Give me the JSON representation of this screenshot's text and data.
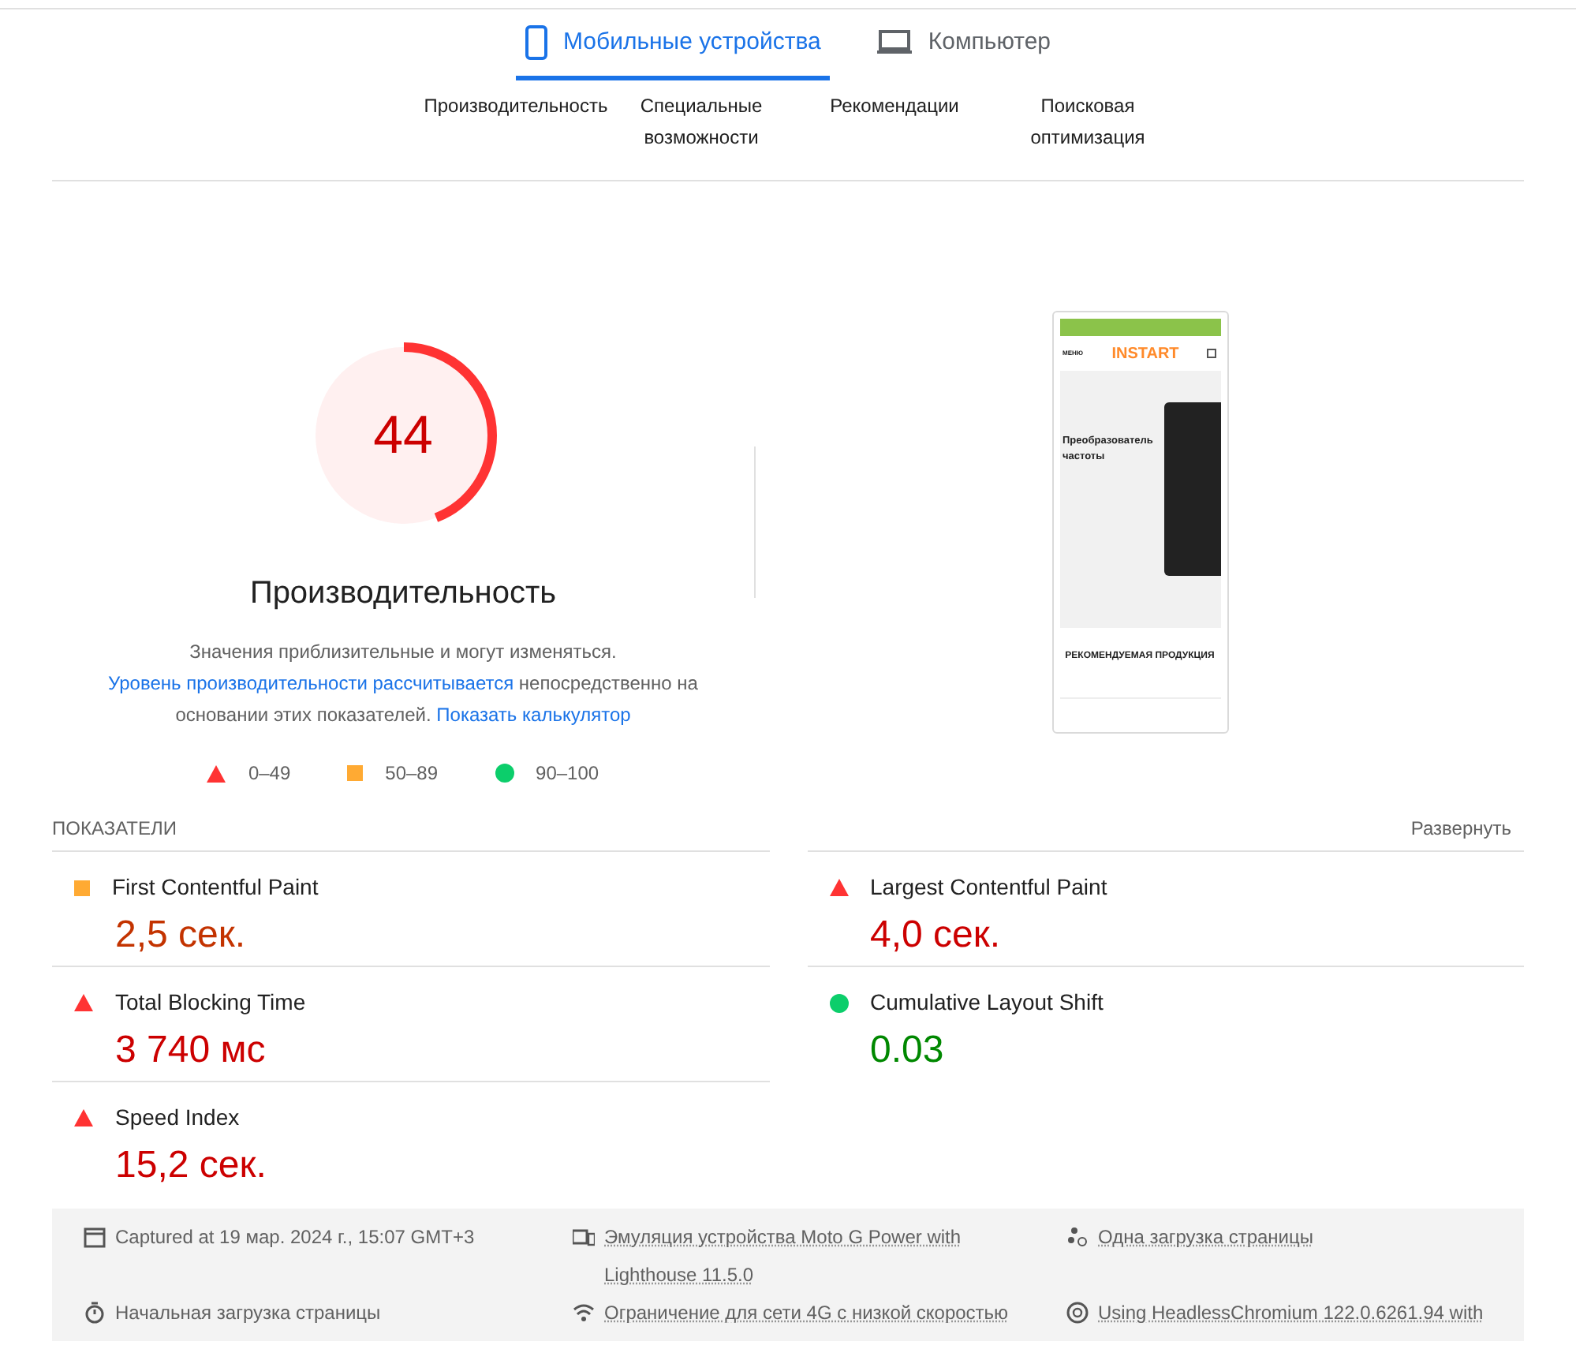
{
  "device_tabs": [
    {
      "label": "Мобильные устройства",
      "kind": "mobile",
      "selected": true
    },
    {
      "label": "Компьютер",
      "kind": "desktop",
      "selected": false
    }
  ],
  "category_tabs": [
    "Производительность",
    "Специальные возможности",
    "Рекомендации",
    "Поисковая оптимизация"
  ],
  "score": {
    "value": "44",
    "level": 0.44,
    "title": "Производительность"
  },
  "description": [
    {
      "kind": "text",
      "text": "Значения приблизительные и могут изменяться."
    },
    {
      "kind": "link",
      "text": "Уровень производительности рассчитывается"
    },
    {
      "kind": "text",
      "text": "непосредственно на основании этих показателей."
    },
    {
      "kind": "link",
      "text": "Показать калькулятор"
    }
  ],
  "legend": [
    {
      "kind": "fail",
      "label": "0–49"
    },
    {
      "kind": "average",
      "label": "50–89"
    },
    {
      "kind": "pass",
      "label": "90–100"
    }
  ],
  "preview": {
    "menu": "МЕНЮ",
    "logo": "INSTART",
    "heading": "Преобразователь частоты",
    "section": "РЕКОМЕНДУЕМАЯ ПРОДУКЦИЯ"
  },
  "metrics_header": {
    "title": "ПОКАЗАТЕЛИ",
    "toggle": "Развернуть"
  },
  "metrics": [
    {
      "name": "First Contentful Paint",
      "value": "2,5 сек.",
      "kind": "average"
    },
    {
      "name": "Largest Contentful Paint",
      "value": "4,0 сек.",
      "kind": "fail"
    },
    {
      "name": "Total Blocking Time",
      "value": "3 740 мс",
      "kind": "fail"
    },
    {
      "name": "Cumulative Layout Shift",
      "value": "0.03",
      "kind": "pass"
    },
    {
      "name": "Speed Index",
      "value": "15,2 сек.",
      "kind": "fail"
    }
  ],
  "footer": [
    {
      "kind": "calendar",
      "text": "Captured at 19 мар. 2024 г., 15:07 GMT+3",
      "link": false
    },
    {
      "kind": "devices",
      "text": "Эмуляция устройства Moto G Power with Lighthouse 11.5.0",
      "link": true
    },
    {
      "kind": "dots",
      "text": "Одна загрузка страницы",
      "link": true
    },
    {
      "kind": "timer",
      "text": "Начальная загрузка страницы",
      "link": false
    },
    {
      "kind": "wifi",
      "text": "Ограничение для сети 4G с низкой скоростью",
      "link": true
    },
    {
      "kind": "chrome",
      "text": "Using HeadlessChromium 122.0.6261.94 with",
      "link": true
    }
  ]
}
